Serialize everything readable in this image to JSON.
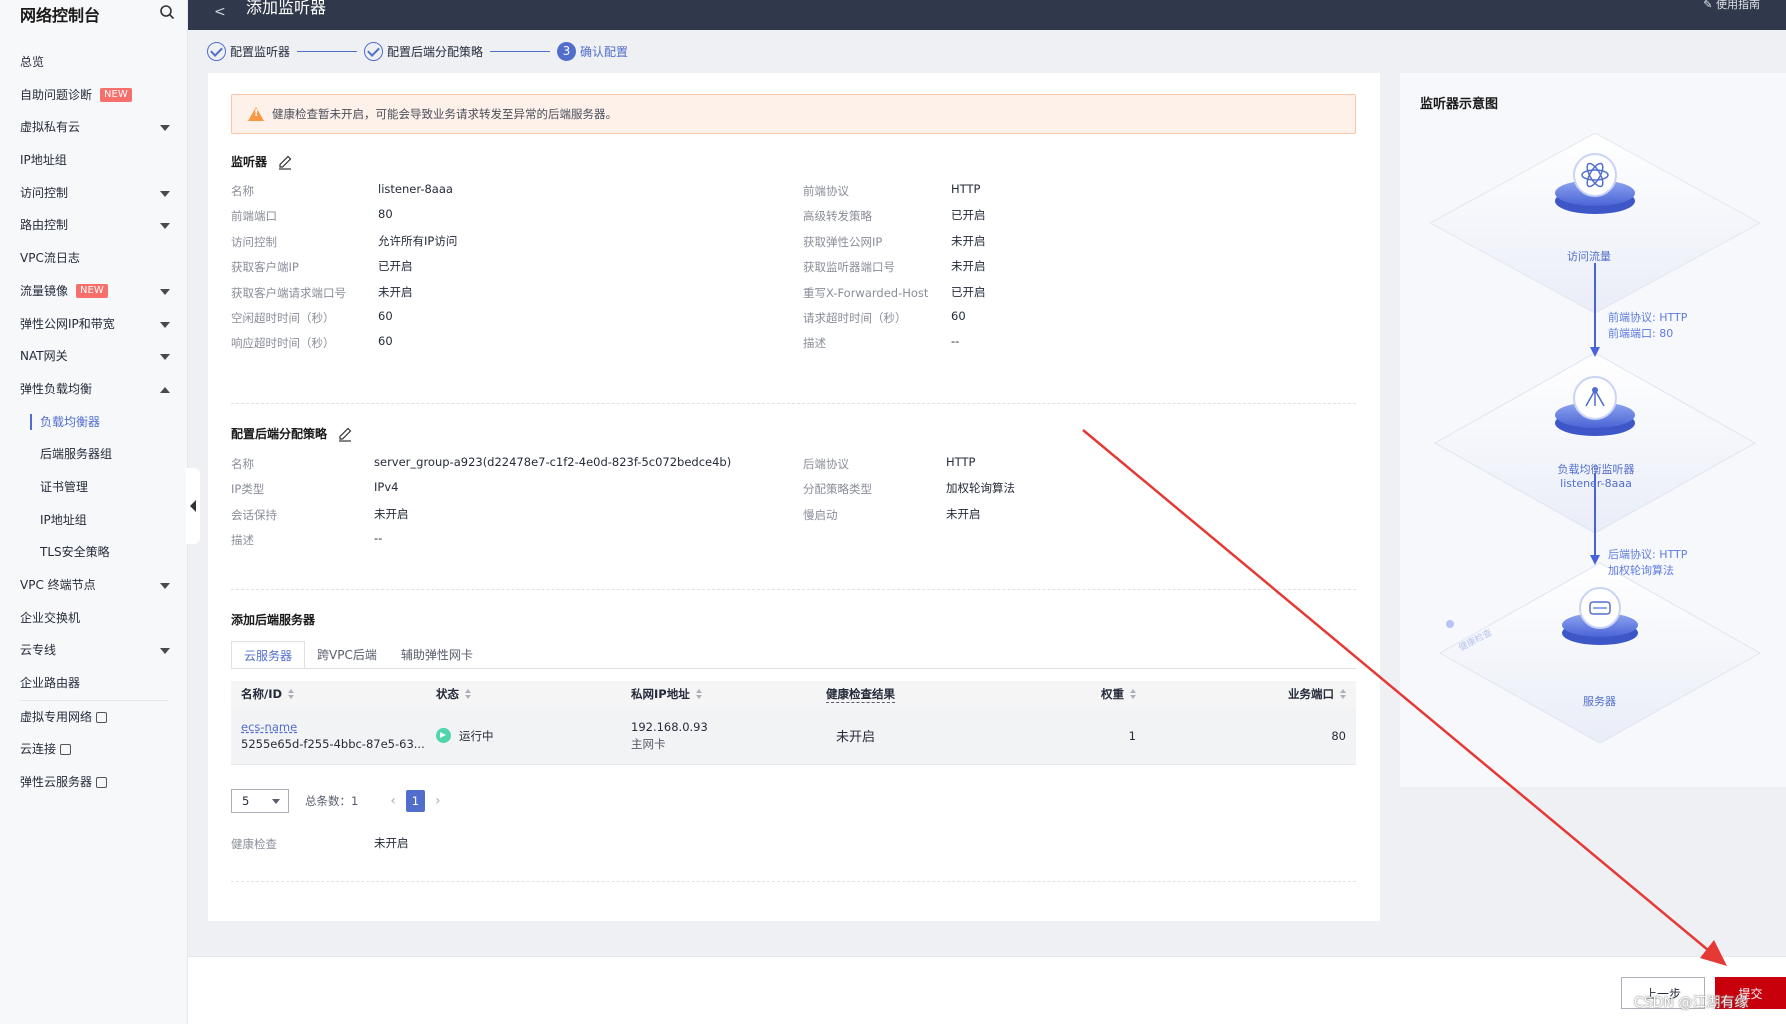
{
  "sidebar": {
    "title": "网络控制台",
    "items": [
      {
        "label": "总览"
      },
      {
        "label": "自助问题诊断",
        "badge": "NEW"
      },
      {
        "label": "虚拟私有云"
      },
      {
        "label": "IP地址组"
      },
      {
        "label": "访问控制"
      },
      {
        "label": "路由控制"
      },
      {
        "label": "VPC流日志"
      },
      {
        "label": "流量镜像",
        "badge": "NEW"
      },
      {
        "label": "弹性公网IP和带宽"
      },
      {
        "label": "NAT网关"
      },
      {
        "label": "弹性负载均衡"
      },
      {
        "label": "负载均衡器"
      },
      {
        "label": "后端服务器组"
      },
      {
        "label": "证书管理"
      },
      {
        "label": "IP地址组"
      },
      {
        "label": "TLS安全策略"
      },
      {
        "label": "VPC 终端节点"
      },
      {
        "label": "企业交换机"
      },
      {
        "label": "云专线"
      },
      {
        "label": "企业路由器"
      },
      {
        "label": "虚拟专用网络"
      },
      {
        "label": "云连接"
      },
      {
        "label": "弹性云服务器"
      }
    ]
  },
  "header": {
    "back": "<",
    "title": "添加监听器",
    "guide": "使用指南"
  },
  "steps": [
    {
      "label": "配置监听器",
      "state": "done"
    },
    {
      "label": "配置后端分配策略",
      "state": "done"
    },
    {
      "label": "确认配置",
      "state": "current",
      "num": "3"
    }
  ],
  "warning": "健康检查暂未开启，可能会导致业务请求转发至异常的后端服务器。",
  "listener": {
    "title": "监听器",
    "left": [
      {
        "label": "名称",
        "value": "listener-8aaa"
      },
      {
        "label": "前端端口",
        "value": "80"
      },
      {
        "label": "访问控制",
        "value": "允许所有IP访问"
      },
      {
        "label": "获取客户端IP",
        "value": "已开启"
      },
      {
        "label": "获取客户端请求端口号",
        "value": "未开启"
      },
      {
        "label": "空闲超时时间（秒）",
        "value": "60"
      },
      {
        "label": "响应超时时间（秒）",
        "value": "60"
      }
    ],
    "right": [
      {
        "label": "前端协议",
        "value": "HTTP"
      },
      {
        "label": "高级转发策略",
        "value": "已开启"
      },
      {
        "label": "获取弹性公网IP",
        "value": "未开启"
      },
      {
        "label": "获取监听器端口号",
        "value": "未开启"
      },
      {
        "label": "重写X-Forwarded-Host",
        "value": "已开启"
      },
      {
        "label": "请求超时时间（秒）",
        "value": "60"
      },
      {
        "label": "描述",
        "value": "--"
      }
    ]
  },
  "backend_policy": {
    "title": "配置后端分配策略",
    "left": [
      {
        "label": "名称",
        "value": "server_group-a923(d22478e7-c1f2-4e0d-823f-5c072bedce4b)"
      },
      {
        "label": "IP类型",
        "value": "IPv4"
      },
      {
        "label": "会话保持",
        "value": "未开启"
      },
      {
        "label": "描述",
        "value": "--"
      }
    ],
    "right": [
      {
        "label": "后端协议",
        "value": "HTTP"
      },
      {
        "label": "分配策略类型",
        "value": "加权轮询算法"
      },
      {
        "label": "慢启动",
        "value": "未开启"
      }
    ]
  },
  "backend_servers": {
    "title": "添加后端服务器",
    "tabs": [
      "云服务器",
      "跨VPC后端",
      "辅助弹性网卡"
    ],
    "columns": [
      "名称/ID",
      "状态",
      "私网IP地址",
      "健康检查结果",
      "权重",
      "业务端口"
    ],
    "rows": [
      {
        "name": "ecs-name",
        "id": "5255e65d-f255-4bbc-87e5-63...",
        "status": "运行中",
        "ip": "192.168.0.93",
        "nic": "主网卡",
        "health": "未开启",
        "weight": "1",
        "port": "80"
      }
    ],
    "page_size": "5",
    "total": "总条数：1",
    "page": "1",
    "health_check_label": "健康检查",
    "health_check_value": "未开启"
  },
  "diagram": {
    "title": "监听器示意图",
    "node_traffic": "访问流量",
    "note1_line1": "前端协议: HTTP",
    "note1_line2": "前端端口: 80",
    "node_lb_line1": "负载均衡监听器",
    "node_lb_line2": "listener-8aaa",
    "note2_line1": "后端协议: HTTP",
    "note2_line2": "加权轮询算法",
    "node_server": "服务器",
    "health_tag": "健康检查"
  },
  "footer": {
    "prev": "上一步",
    "submit": "提交",
    "watermark": "CSDN @江湖有缘"
  },
  "colors": {
    "brand": "#526ecc",
    "submit": "#c7000b",
    "header_bg": "#30394b",
    "warning": "#fa9841",
    "annotation_arrow": "#e53935"
  }
}
